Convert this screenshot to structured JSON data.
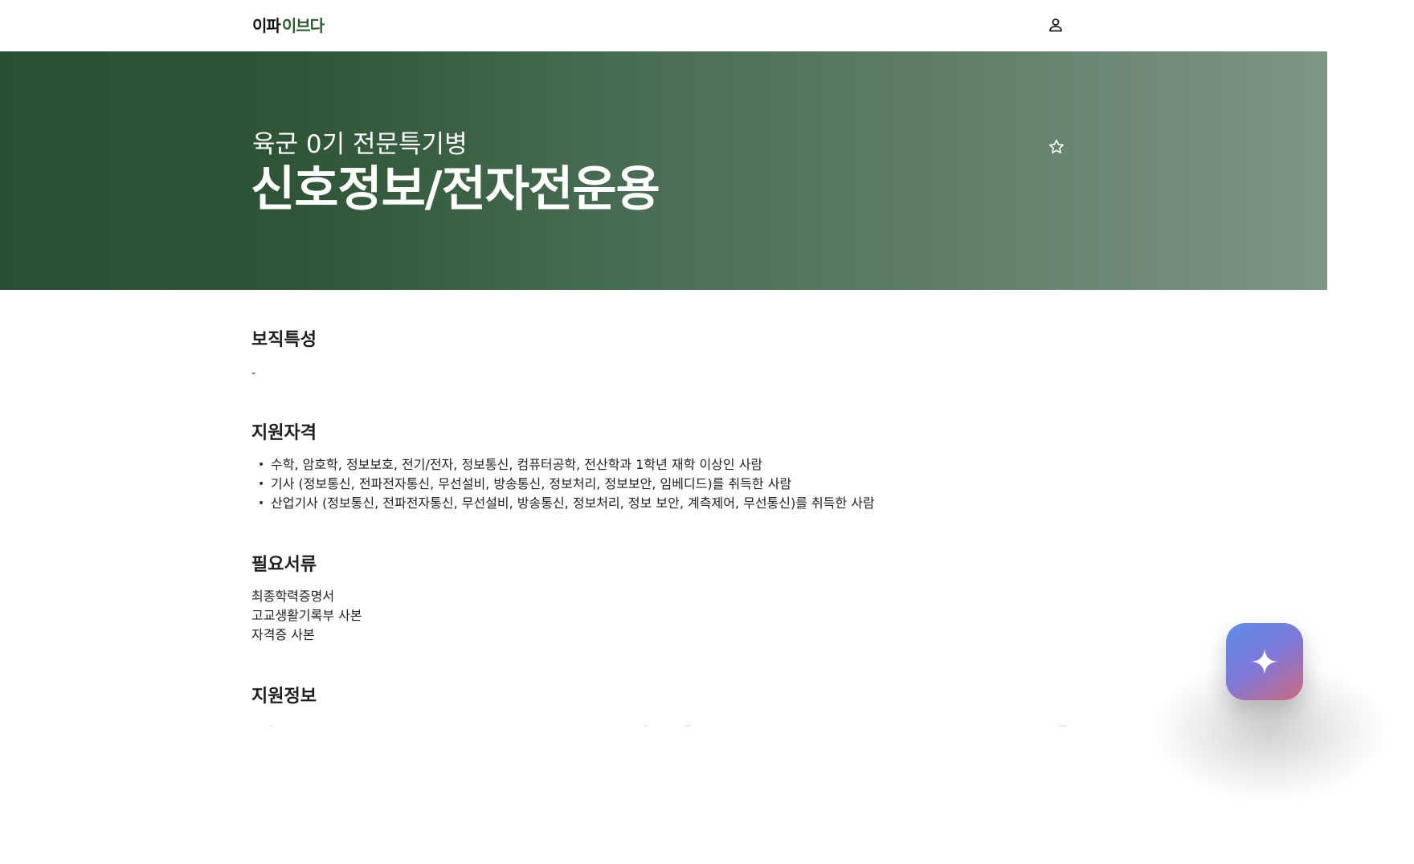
{
  "header": {
    "logo_part1": "이파",
    "logo_part2": "이브다",
    "user_icon": "user-icon"
  },
  "hero": {
    "subtitle": "육군 0기 전문특기병",
    "title": "신호정보/전자전운용",
    "favorite_icon": "star-outline-icon"
  },
  "sections": {
    "traits": {
      "heading": "보직특성",
      "text": "-"
    },
    "eligibility": {
      "heading": "지원자격",
      "items": [
        "수학, 암호학, 정보보호, 전기/전자, 정보통신, 컴퓨터공학, 전산학과 1학년 재학 이상인 사람",
        "기사 (정보통신, 전파전자통신, 무선설비, 방송통신, 정보처리, 정보보안, 임베디드)를 취득한 사람",
        "산업기사 (정보통신, 전파전자통신, 무선설비, 방송통신, 정보처리, 정보 보안, 계측제어, 무선통신)를 취득한 사람"
      ]
    },
    "documents": {
      "heading": "필요서류",
      "items": [
        "최종학력증명서",
        "고교생활기록부 사본",
        "자격증 사본"
      ]
    },
    "apply_info": {
      "heading": "지원정보"
    }
  },
  "fab": {
    "icon": "sparkle-icon"
  },
  "colors": {
    "brand_dark": "#141414",
    "brand_green": "#2f5a2f",
    "hero_start": "#2b4f33",
    "hero_end": "#7e9585",
    "fab_start": "#5a8de6",
    "fab_end": "#d06a7c"
  }
}
